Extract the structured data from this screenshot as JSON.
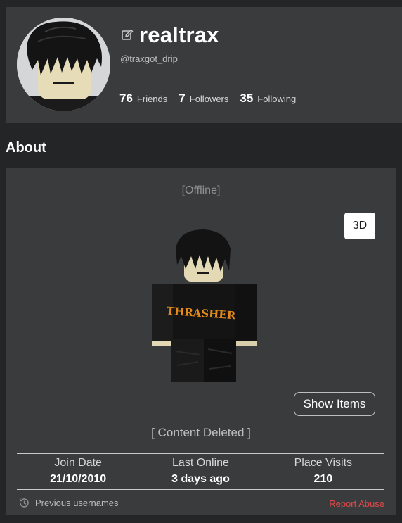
{
  "profile": {
    "display_name": "realtrax",
    "username": "@traxgot_drip",
    "stats": [
      {
        "count": "76",
        "label": "Friends"
      },
      {
        "count": "7",
        "label": "Followers"
      },
      {
        "count": "35",
        "label": "Following"
      }
    ]
  },
  "about": {
    "title": "About",
    "presence": "[Offline]",
    "view_mode_button": "3D",
    "show_items_button": "Show Items",
    "description": "[ Content Deleted ]",
    "info": [
      {
        "label": "Join Date",
        "value": "21/10/2010"
      },
      {
        "label": "Last Online",
        "value": "3 days ago"
      },
      {
        "label": "Place Visits",
        "value": "210"
      }
    ],
    "previous_usernames_label": "Previous usernames",
    "report_abuse_label": "Report Abuse",
    "shirt_logo_text": "THRASHER"
  },
  "icons": {
    "edit": "edit-icon",
    "history": "history-icon"
  },
  "colors": {
    "page_bg": "#232527",
    "card_bg": "#393b3d",
    "report_abuse": "#e24a4a",
    "avatar_bg": "#d4d6d8"
  }
}
